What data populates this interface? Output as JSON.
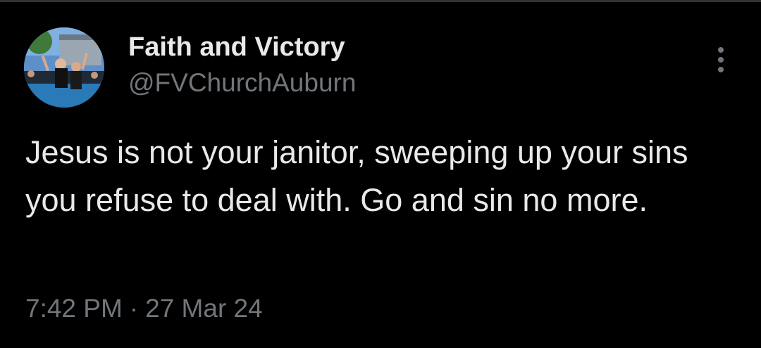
{
  "author": {
    "display_name": "Faith and Victory",
    "handle": "@FVChurchAuburn",
    "avatar_icon": "profile-photo-icon"
  },
  "tweet": {
    "text": "Jesus is not your janitor, sweeping up your sins you refuse to deal with. Go and sin no more.",
    "time": "7:42 PM",
    "separator": "·",
    "date": "27 Mar 24"
  },
  "menu": {
    "icon": "more-options-icon"
  },
  "colors": {
    "background": "#000000",
    "primary_text": "#e7e9ea",
    "secondary_text": "#71767b"
  }
}
